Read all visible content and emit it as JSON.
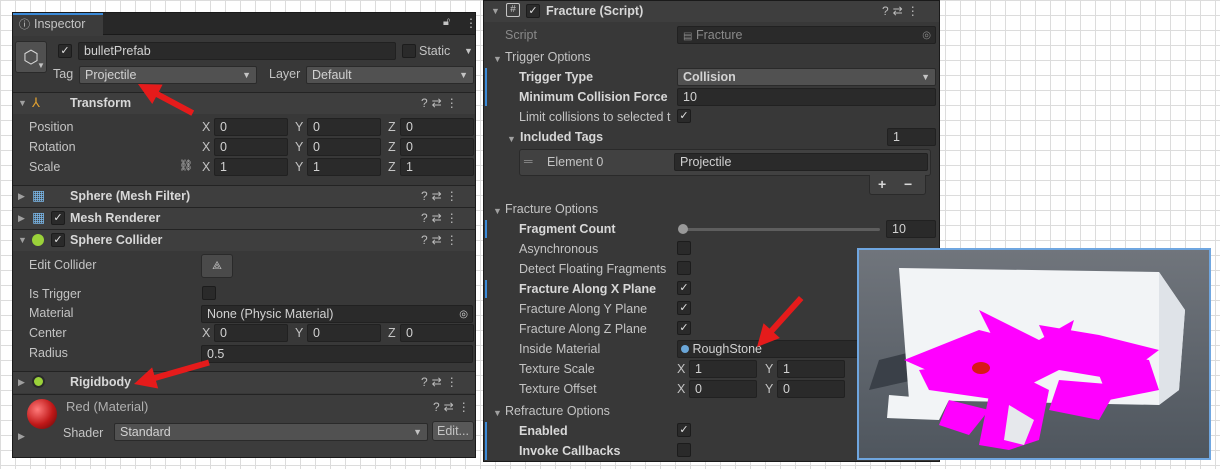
{
  "inspector": {
    "tab_title": "Inspector",
    "object_name": "bulletPrefab",
    "static_label": "Static",
    "tag_label": "Tag",
    "tag_value": "Projectile",
    "layer_label": "Layer",
    "layer_value": "Default",
    "transform": {
      "title": "Transform",
      "position": "Position",
      "rotation": "Rotation",
      "scale": "Scale",
      "pos": [
        "0",
        "0",
        "0"
      ],
      "rot": [
        "0",
        "0",
        "0"
      ],
      "scl": [
        "1",
        "1",
        "1"
      ],
      "axes": [
        "X",
        "Y",
        "Z"
      ]
    },
    "mesh_filter": "Sphere (Mesh Filter)",
    "mesh_renderer": "Mesh Renderer",
    "sphere_collider": {
      "title": "Sphere Collider",
      "edit_collider": "Edit Collider",
      "is_trigger": "Is Trigger",
      "material": "Material",
      "material_value": "None (Physic Material)",
      "center": "Center",
      "center_vals": [
        "0",
        "0",
        "0"
      ],
      "radius": "Radius",
      "radius_value": "0.5"
    },
    "rigidbody": "Rigidbody",
    "material": {
      "name": "Red (Material)",
      "shader_label": "Shader",
      "shader_value": "Standard",
      "edit_button": "Edit..."
    }
  },
  "fracture": {
    "title": "Fracture (Script)",
    "script_label": "Script",
    "script_value": "Fracture",
    "trigger_options": "Trigger Options",
    "trigger_type": "Trigger Type",
    "trigger_type_value": "Collision",
    "min_force": "Minimum Collision Force",
    "min_force_value": "10",
    "limit_collisions": "Limit collisions to selected t",
    "included_tags": "Included Tags",
    "included_tags_count": "1",
    "element0": "Element 0",
    "element0_value": "Projectile",
    "plus": "+",
    "minus": "−",
    "fracture_options": "Fracture Options",
    "fragment_count": "Fragment Count",
    "fragment_count_value": "10",
    "asynchronous": "Asynchronous",
    "detect_floating": "Detect Floating Fragments",
    "along_x": "Fracture Along X Plane",
    "along_y": "Fracture Along Y Plane",
    "along_z": "Fracture Along Z Plane",
    "inside_material": "Inside Material",
    "inside_material_value": "RoughStone",
    "texture_scale": "Texture Scale",
    "texture_scale_vals": [
      "1",
      "1"
    ],
    "texture_offset": "Texture Offset",
    "texture_offset_vals": [
      "0",
      "0"
    ],
    "axes": [
      "X",
      "Y"
    ],
    "refracture_options": "Refracture Options",
    "enabled": "Enabled",
    "invoke_callbacks": "Invoke Callbacks"
  },
  "colors": {
    "accent_blue": "#3b8ad8",
    "arrow_red": "#e51b1b",
    "fragment_magenta": "#ff00ff"
  }
}
